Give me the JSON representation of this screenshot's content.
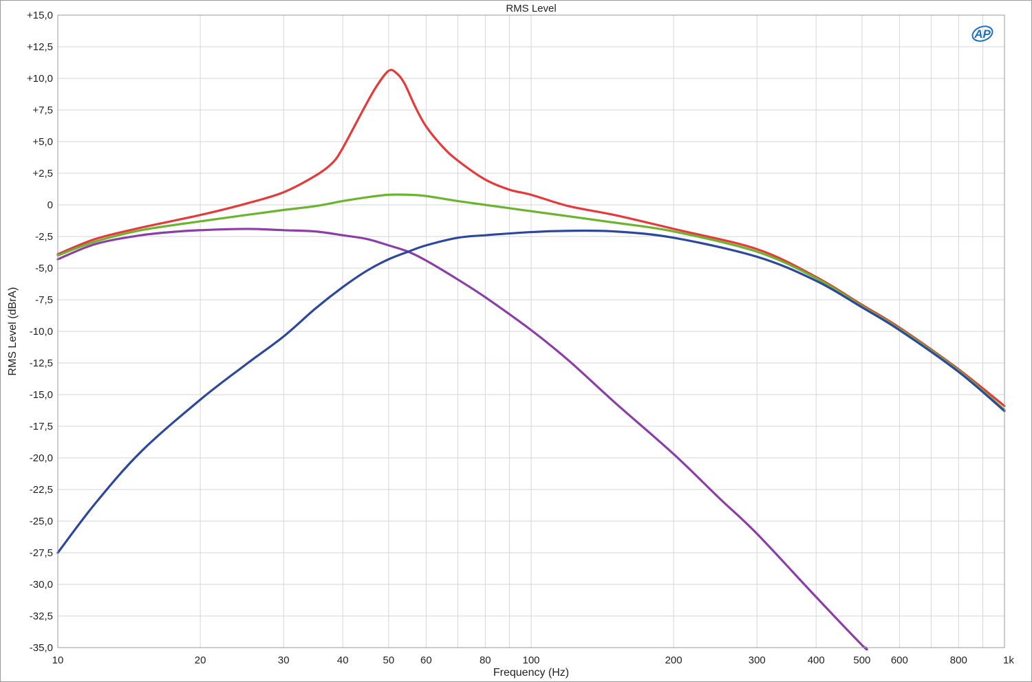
{
  "chart_data": {
    "type": "line",
    "title": "RMS Level",
    "xlabel": "Frequency (Hz)",
    "ylabel": "RMS Level (dBrA)",
    "x_scale": "log",
    "xlim": [
      10,
      1000
    ],
    "ylim": [
      -35,
      15
    ],
    "grid": true,
    "logo": "AP",
    "colors": {
      "frame": "#9a9a9a",
      "grid": "#d6d6d6",
      "text": "#222222",
      "logo": "#1f6fc0"
    },
    "x_ticks": [
      {
        "value": 10,
        "label": "10"
      },
      {
        "value": 20,
        "label": "20"
      },
      {
        "value": 30,
        "label": "30"
      },
      {
        "value": 40,
        "label": "40"
      },
      {
        "value": 50,
        "label": "50"
      },
      {
        "value": 60,
        "label": "60"
      },
      {
        "value": 80,
        "label": "80"
      },
      {
        "value": 100,
        "label": "100"
      },
      {
        "value": 200,
        "label": "200"
      },
      {
        "value": 300,
        "label": "300"
      },
      {
        "value": 400,
        "label": "400"
      },
      {
        "value": 500,
        "label": "500"
      },
      {
        "value": 600,
        "label": "600"
      },
      {
        "value": 800,
        "label": "800"
      },
      {
        "value": 1000,
        "label": "1k"
      }
    ],
    "x_minor_grid": [
      70,
      90,
      700,
      900
    ],
    "y_ticks": [
      {
        "value": 15,
        "label": "+15,0"
      },
      {
        "value": 12.5,
        "label": "+12,5"
      },
      {
        "value": 10,
        "label": "+10,0"
      },
      {
        "value": 7.5,
        "label": "+7,5"
      },
      {
        "value": 5,
        "label": "+5,0"
      },
      {
        "value": 2.5,
        "label": "+2,5"
      },
      {
        "value": 0,
        "label": "0"
      },
      {
        "value": -2.5,
        "label": "-2,5"
      },
      {
        "value": -5,
        "label": "-5,0"
      },
      {
        "value": -7.5,
        "label": "-7,5"
      },
      {
        "value": -10,
        "label": "-10,0"
      },
      {
        "value": -12.5,
        "label": "-12,5"
      },
      {
        "value": -15,
        "label": "-15,0"
      },
      {
        "value": -17.5,
        "label": "-17,5"
      },
      {
        "value": -20,
        "label": "-20,0"
      },
      {
        "value": -22.5,
        "label": "-22,5"
      },
      {
        "value": -25,
        "label": "-25,0"
      },
      {
        "value": -27.5,
        "label": "-27,5"
      },
      {
        "value": -30,
        "label": "-30,0"
      },
      {
        "value": -32.5,
        "label": "-32,5"
      },
      {
        "value": -35,
        "label": "-35,0"
      }
    ],
    "series": [
      {
        "color": "#e8393a",
        "x": [
          10,
          12,
          15,
          20,
          25,
          30,
          35,
          38,
          40,
          44,
          47,
          50,
          52,
          54,
          57,
          60,
          65,
          70,
          80,
          90,
          100,
          120,
          150,
          200,
          300,
          400,
          500,
          600,
          800,
          1000
        ],
        "y": [
          -3.9,
          -2.7,
          -1.8,
          -0.8,
          0.1,
          1.0,
          2.3,
          3.3,
          4.5,
          7.4,
          9.3,
          10.6,
          10.4,
          9.6,
          7.7,
          6.2,
          4.6,
          3.5,
          2.0,
          1.2,
          0.8,
          -0.1,
          -0.8,
          -1.9,
          -3.5,
          -5.7,
          -7.9,
          -9.7,
          -13.0,
          -15.9
        ]
      },
      {
        "color": "#6ab42e",
        "x": [
          10,
          12,
          15,
          20,
          25,
          30,
          35,
          40,
          45,
          50,
          55,
          60,
          70,
          80,
          100,
          120,
          150,
          200,
          300,
          400,
          500,
          600,
          800,
          1000
        ],
        "y": [
          -4.0,
          -2.9,
          -2.0,
          -1.3,
          -0.8,
          -0.4,
          -0.1,
          0.3,
          0.6,
          0.8,
          0.8,
          0.7,
          0.3,
          0.0,
          -0.5,
          -0.9,
          -1.4,
          -2.1,
          -3.7,
          -5.8,
          -8.0,
          -9.8,
          -13.1,
          -16.2
        ]
      },
      {
        "color": "#8c3ea8",
        "x": [
          10,
          12,
          15,
          18,
          20,
          25,
          30,
          35,
          40,
          45,
          50,
          55,
          60,
          70,
          80,
          100,
          120,
          150,
          200,
          250,
          300,
          400,
          500,
          510
        ],
        "y": [
          -4.3,
          -3.1,
          -2.4,
          -2.1,
          -2.0,
          -1.9,
          -2.0,
          -2.1,
          -2.4,
          -2.7,
          -3.2,
          -3.7,
          -4.4,
          -5.9,
          -7.3,
          -9.9,
          -12.3,
          -15.6,
          -19.7,
          -23.2,
          -26.0,
          -31.0,
          -34.8,
          -35.0
        ]
      },
      {
        "color": "#2d47a0",
        "x": [
          10,
          12,
          15,
          20,
          25,
          30,
          35,
          40,
          45,
          50,
          55,
          60,
          70,
          80,
          100,
          120,
          150,
          200,
          300,
          400,
          500,
          600,
          800,
          1000
        ],
        "y": [
          -27.5,
          -23.6,
          -19.5,
          -15.4,
          -12.6,
          -10.4,
          -8.2,
          -6.5,
          -5.2,
          -4.3,
          -3.7,
          -3.2,
          -2.6,
          -2.4,
          -2.15,
          -2.05,
          -2.1,
          -2.6,
          -4.1,
          -6.0,
          -8.1,
          -9.9,
          -13.2,
          -16.3
        ]
      }
    ]
  }
}
